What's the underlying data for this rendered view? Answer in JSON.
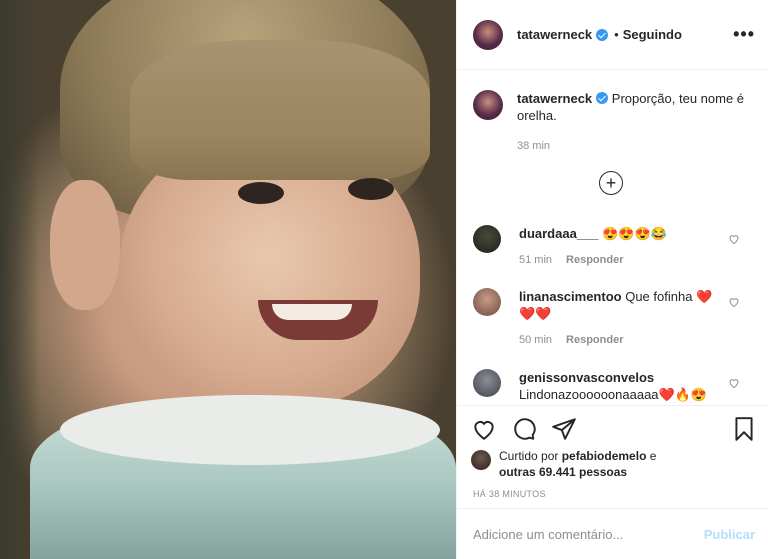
{
  "post": {
    "username": "tatawerneck",
    "dot": "•",
    "follow_status": "Seguindo",
    "more": "•••"
  },
  "caption": {
    "username": "tatawerneck",
    "text": "Proporção, teu nome é orelha.",
    "time": "38 min"
  },
  "load_more_icon": "plus-circle-icon",
  "comments": [
    {
      "username": "duardaaa___",
      "text": "😍😍😍😂",
      "time": "51 min",
      "reply": "Responder"
    },
    {
      "username": "linanascimentoo",
      "text": "Que fofinha ❤️ ❤️❤️",
      "time": "50 min",
      "reply": "Responder"
    },
    {
      "username": "genissonvasconvelos",
      "text": "Lindonazoooooonaaaaa❤️🔥😍",
      "time": "",
      "reply": ""
    }
  ],
  "actions": {
    "liked_prefix": "Curtido por",
    "liked_user": "pefabiodemelo",
    "liked_join": "e",
    "liked_others": "outras 69.441 pessoas",
    "timestamp": "HÁ 38 MINUTOS"
  },
  "add_comment": {
    "placeholder": "Adicione um comentário...",
    "publish": "Publicar"
  },
  "colors": {
    "verified": "#3897f0",
    "publish_disabled": "#b2dffc"
  }
}
